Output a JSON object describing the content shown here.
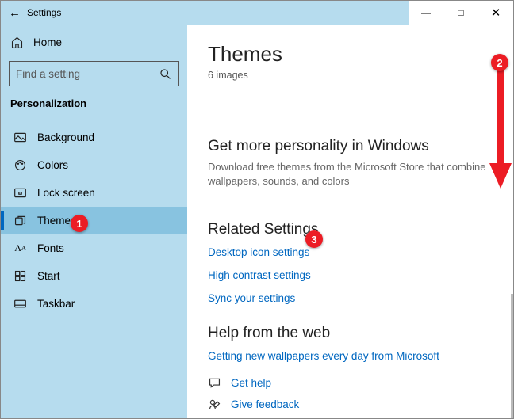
{
  "window": {
    "title": "Settings"
  },
  "sidebar": {
    "home": "Home",
    "search_placeholder": "Find a setting",
    "category": "Personalization",
    "items": [
      {
        "label": "Background"
      },
      {
        "label": "Colors"
      },
      {
        "label": "Lock screen"
      },
      {
        "label": "Themes"
      },
      {
        "label": "Fonts"
      },
      {
        "label": "Start"
      },
      {
        "label": "Taskbar"
      }
    ]
  },
  "main": {
    "title": "Themes",
    "subtitle": "6 images",
    "more_heading": "Get more personality in Windows",
    "more_desc": "Download free themes from the Microsoft Store that combine wallpapers, sounds, and colors",
    "related_heading": "Related Settings",
    "related_links": {
      "desktop_icon": "Desktop icon settings",
      "high_contrast": "High contrast settings",
      "sync": "Sync your settings"
    },
    "help_heading": "Help from the web",
    "help_link": "Getting new wallpapers every day from Microsoft",
    "get_help": "Get help",
    "give_feedback": "Give feedback"
  },
  "annotations": {
    "b1": "1",
    "b2": "2",
    "b3": "3"
  }
}
